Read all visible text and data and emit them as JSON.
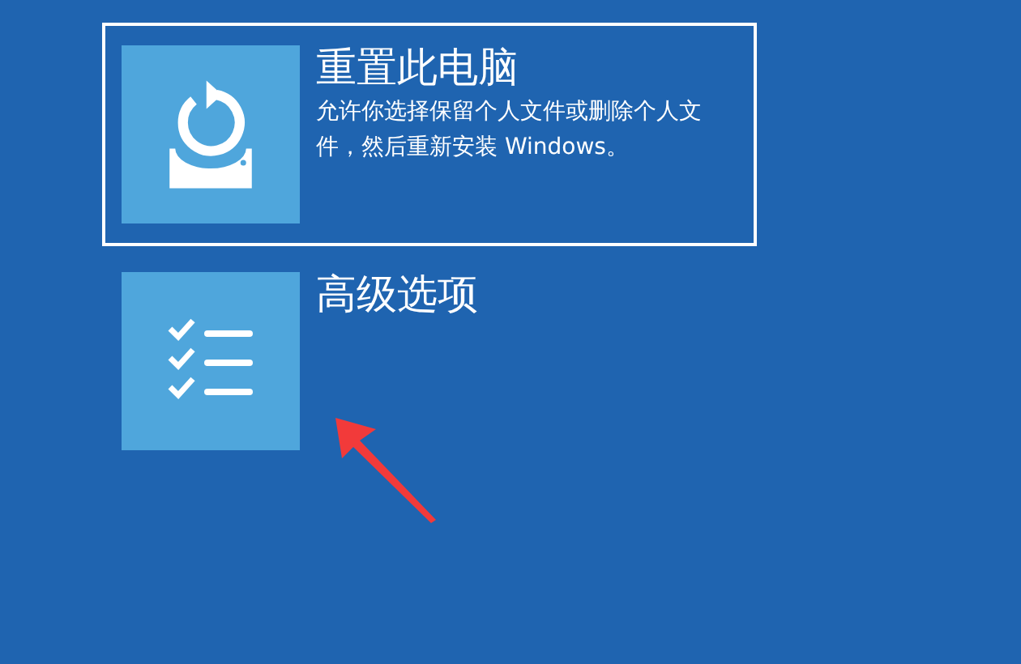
{
  "options": [
    {
      "kind": "reset",
      "title": "重置此电脑",
      "description": "允许你选择保留个人文件或删除个人文件，然后重新安装 Windows。",
      "selected": true
    },
    {
      "kind": "tools",
      "title": "高级选项",
      "selected": false
    }
  ]
}
